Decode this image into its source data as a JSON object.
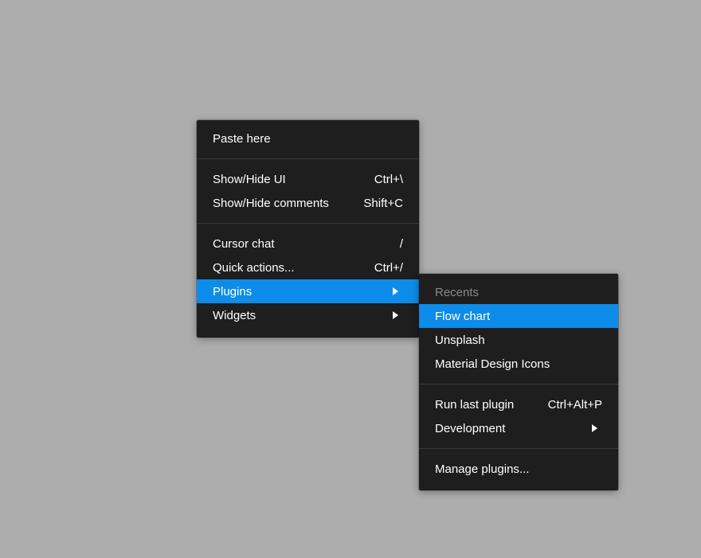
{
  "main_menu": {
    "paste_here": "Paste here",
    "show_hide_ui": {
      "label": "Show/Hide UI",
      "shortcut": "Ctrl+\\"
    },
    "show_hide_comments": {
      "label": "Show/Hide comments",
      "shortcut": "Shift+C"
    },
    "cursor_chat": {
      "label": "Cursor chat",
      "shortcut": "/"
    },
    "quick_actions": {
      "label": "Quick actions...",
      "shortcut": "Ctrl+/"
    },
    "plugins": {
      "label": "Plugins"
    },
    "widgets": {
      "label": "Widgets"
    }
  },
  "plugins_submenu": {
    "recents_header": "Recents",
    "flow_chart": "Flow chart",
    "unsplash": "Unsplash",
    "material_design_icons": "Material Design Icons",
    "run_last_plugin": {
      "label": "Run last plugin",
      "shortcut": "Ctrl+Alt+P"
    },
    "development": {
      "label": "Development"
    },
    "manage_plugins": "Manage plugins..."
  },
  "colors": {
    "canvas_background": "#adadad",
    "menu_background": "#1e1e1e",
    "highlight": "#0d8ce9",
    "text": "#ffffff",
    "muted_text": "#8a8a8a"
  }
}
